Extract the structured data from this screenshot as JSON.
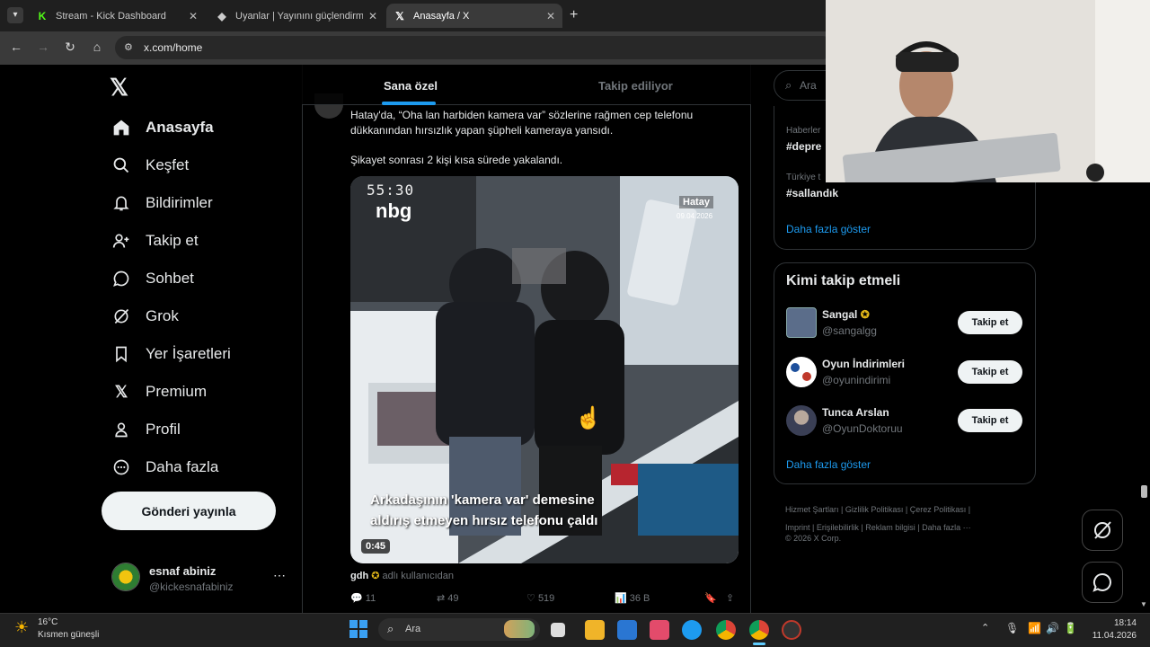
{
  "browser": {
    "tabs": [
      {
        "title": "Stream - Kick Dashboard",
        "favicon": "K"
      },
      {
        "title": "Uyanlar | Yayınını güçlendirmek",
        "favicon": "◆"
      },
      {
        "title": "Anasayfa / X",
        "favicon": "𝕏"
      }
    ],
    "url": "x.com/home"
  },
  "nav": {
    "logo": "𝕏",
    "items": [
      {
        "label": "Anasayfa",
        "icon": "home-icon",
        "glyph": "⌂"
      },
      {
        "label": "Keşfet",
        "icon": "search-icon",
        "glyph": "⌕"
      },
      {
        "label": "Bildirimler",
        "icon": "bell-icon",
        "glyph": "🔔"
      },
      {
        "label": "Takip et",
        "icon": "add-user-icon",
        "glyph": "👤"
      },
      {
        "label": "Sohbet",
        "icon": "chat-icon",
        "glyph": "💬"
      },
      {
        "label": "Grok",
        "icon": "grok-icon",
        "glyph": "⊘"
      },
      {
        "label": "Yer İşaretleri",
        "icon": "bookmark-icon",
        "glyph": "🔖"
      },
      {
        "label": "Premium",
        "icon": "x-icon",
        "glyph": "𝕏"
      },
      {
        "label": "Profil",
        "icon": "profile-icon",
        "glyph": "👤"
      },
      {
        "label": "Daha fazla",
        "icon": "more-circle-icon",
        "glyph": "⋯"
      }
    ],
    "post_button": "Gönderi yayınla",
    "account": {
      "name": "esnaf abiniz",
      "handle": "@kickesnafabiniz",
      "more": "⋯"
    }
  },
  "feed": {
    "tabs": [
      "Sana özel",
      "Takip ediliyor"
    ],
    "post": {
      "text1": "Hatay'da, “Oha lan harbiden kamera var” sözlerine rağmen cep telefonu dükkanından hırsızlık yapan şüpheli kameraya yansıdı.",
      "text2": "Şikayet sonrası 2 kişi kısa sürede yakalandı.",
      "video": {
        "timestamp_overlay": "55:30",
        "location": "Hatay",
        "date": "09.04.2026",
        "caption_line1": "Arkadaşının 'kamera var' demesine",
        "caption_line2": "aldırış etmeyen hırsız telefonu çaldı",
        "duration": "0:45",
        "brand": "nbg"
      },
      "source_user": "gdh",
      "source_text": "adlı kullanıcıdan",
      "stats": {
        "replies": "11",
        "reposts": "49",
        "likes": "519",
        "views": "36 B"
      }
    }
  },
  "right": {
    "search_placeholder": "Ara",
    "trends": [
      {
        "context": "Haberler",
        "tag": "#depre"
      },
      {
        "context": "Türkiye t",
        "tag": "#sallandık"
      }
    ],
    "trends_more": "Daha fazla göster",
    "who_to_follow": {
      "title": "Kimi takip etmeli",
      "users": [
        {
          "name": "Sangal",
          "handle": "@sangalgg",
          "button": "Takip et"
        },
        {
          "name": "Oyun İndirimleri",
          "handle": "@oyunindirimi",
          "button": "Takip et"
        },
        {
          "name": "Tunca Arslan",
          "handle": "@OyunDoktoruu",
          "button": "Takip et"
        }
      ],
      "more": "Daha fazla göster"
    },
    "footer": {
      "links": [
        "Hizmet Şartları",
        "Gizlilik Politikası",
        "Çerez Politikası",
        "Imprint",
        "Erişilebilirlik",
        "Reklam bilgisi",
        "Daha fazla ···"
      ],
      "copyright": "© 2026 X Corp."
    }
  },
  "taskbar": {
    "weather_temp": "16°C",
    "weather_desc": "Kısmen güneşli",
    "search": "Ara",
    "time": "18:14",
    "date": "11.04.2026"
  },
  "colors": {
    "accent": "#1d9bf0",
    "verified": "#e2b719",
    "text_secondary": "#71767b"
  }
}
